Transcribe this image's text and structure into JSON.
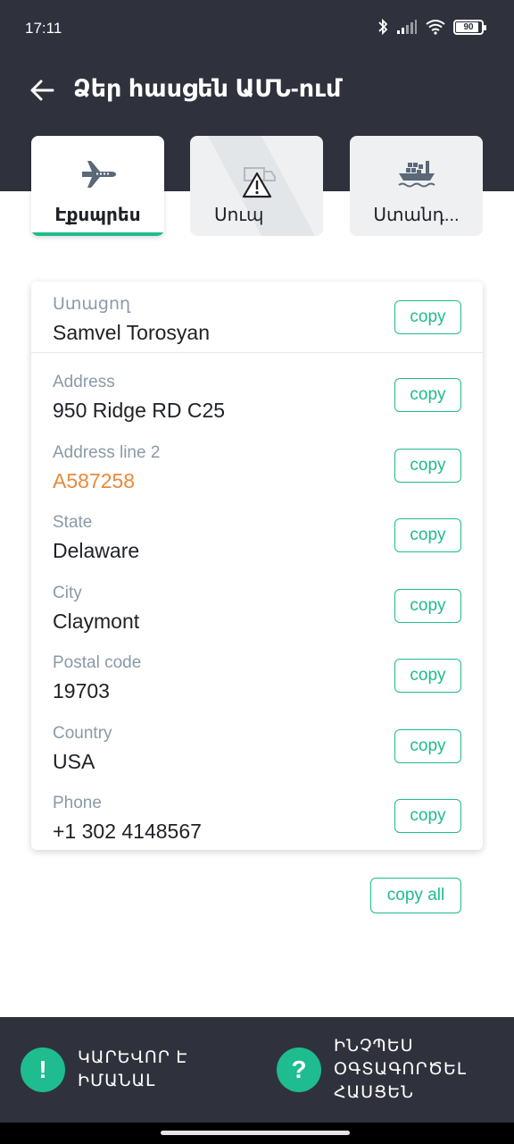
{
  "status_bar": {
    "time": "17:11",
    "battery": "90"
  },
  "header": {
    "title": "Ձեր հասցեն ԱՄՆ-ում"
  },
  "tabs": [
    {
      "label": "Էքսպրես",
      "icon": "airplane-icon",
      "active": true
    },
    {
      "label": "Սուպ",
      "icon": "warning-icon",
      "active": false
    },
    {
      "label": "Ստանդ...",
      "icon": "ship-icon",
      "active": false
    }
  ],
  "recipient": {
    "label": "Ստացող",
    "value": "Samvel Torosyan"
  },
  "fields": [
    {
      "label": "Address",
      "value": "950 Ridge RD C25"
    },
    {
      "label": "Address line 2",
      "value": "A587258"
    },
    {
      "label": "State",
      "value": "Delaware"
    },
    {
      "label": "City",
      "value": "Claymont"
    },
    {
      "label": "Postal code",
      "value": "19703"
    },
    {
      "label": "Country",
      "value": "USA"
    },
    {
      "label": "Phone",
      "value": "+1 302 4148567"
    }
  ],
  "buttons": {
    "copy": "copy",
    "copy_all": "copy all"
  },
  "bottom_bar": {
    "important": {
      "icon_glyph": "!",
      "text": "ԿԱՐԵՎՈՐ Է\nԻՄԱՆԱԼ"
    },
    "how_to": {
      "icon_glyph": "?",
      "text": "ԻՆՉՊԵՍ\nՕԳՏԱԳՈՐԾԵԼ\nՀԱՍՑԵՆ"
    }
  },
  "colors": {
    "accent": "#1ebc8e",
    "header_bg": "#2f323c",
    "highlight": "#e8893a"
  }
}
